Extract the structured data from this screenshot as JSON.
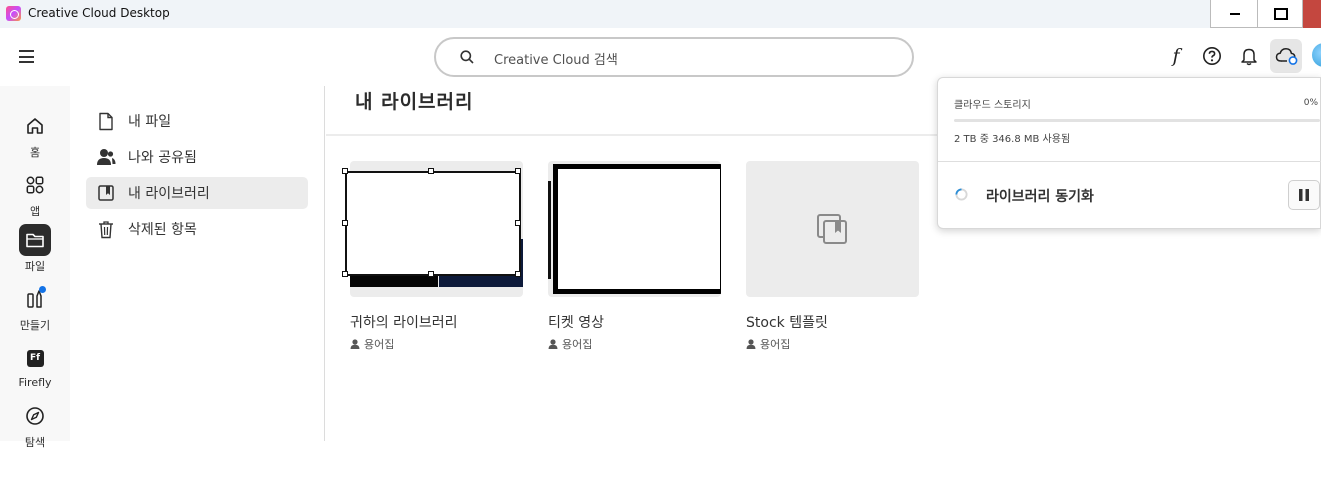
{
  "window": {
    "title": "Creative Cloud Desktop"
  },
  "header": {
    "search_placeholder": "Creative Cloud 검색",
    "font_glyph": "f"
  },
  "rail": {
    "items": [
      {
        "label": "홈",
        "icon": "home-icon"
      },
      {
        "label": "앱",
        "icon": "apps-icon"
      },
      {
        "label": "파일",
        "icon": "folder-icon",
        "active": true
      },
      {
        "label": "만들기",
        "icon": "create-icon"
      },
      {
        "label": "Firefly",
        "icon": "firefly-icon",
        "badge": "Ff"
      },
      {
        "label": "탐색",
        "icon": "discover-icon"
      }
    ]
  },
  "subnav": {
    "items": [
      {
        "label": "내 파일",
        "icon": "file-icon"
      },
      {
        "label": "나와 공유됨",
        "icon": "shared-user-icon"
      },
      {
        "label": "내 라이브러리",
        "icon": "library-icon",
        "active": true
      },
      {
        "label": "삭제된 항목",
        "icon": "trash-icon"
      }
    ]
  },
  "main": {
    "title": "내 라이브러리",
    "cards": [
      {
        "name": "귀하의 라이브러리",
        "owner": "용어집"
      },
      {
        "name": "티켓 영상",
        "owner": "용어집"
      },
      {
        "name": "Stock 템플릿",
        "owner": "용어집"
      }
    ]
  },
  "storage_popover": {
    "title": "클라우드 스토리지",
    "percent_label": "0%",
    "percent_used": 0.0,
    "usage": "2 TB 중 346.8 MB 사용됨",
    "sync_label": "라이브러리 동기화"
  },
  "colors": {
    "accent": "#1473e6",
    "notification_dot": "#1473e6",
    "close_button": "#c4473f"
  }
}
